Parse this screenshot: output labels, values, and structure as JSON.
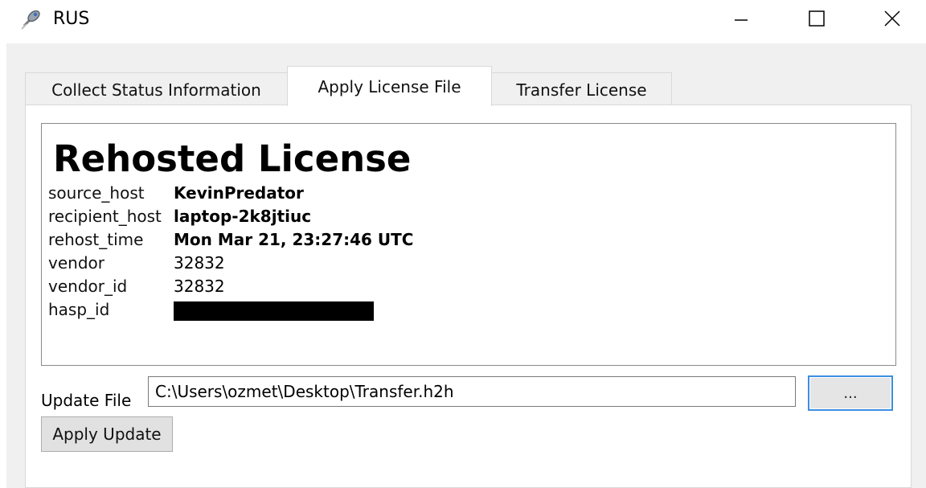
{
  "window": {
    "title": "RUS",
    "app_icon": "satellite-rocket-icon",
    "controls": {
      "minimize_icon": "minimize-icon",
      "maximize_icon": "maximize-icon",
      "close_icon": "close-icon"
    }
  },
  "tabs": [
    {
      "label": "Collect Status Information",
      "active": false
    },
    {
      "label": "Apply License File",
      "active": true
    },
    {
      "label": "Transfer License",
      "active": false
    }
  ],
  "license_info": {
    "heading": "Rehosted License",
    "rows": [
      {
        "key": "source_host",
        "value": "KevinPredator",
        "bold": true
      },
      {
        "key": "recipient_host",
        "value": "laptop-2k8jtiuc",
        "bold": true
      },
      {
        "key": "rehost_time",
        "value": "Mon Mar 21, 23:27:46 UTC",
        "bold": true
      },
      {
        "key": "vendor",
        "value": "32832",
        "bold": false
      },
      {
        "key": "vendor_id",
        "value": "32832",
        "bold": false
      },
      {
        "key": "hasp_id",
        "value": "",
        "redacted": true
      }
    ]
  },
  "update_file": {
    "label": "Update File",
    "value": "C:\\Users\\ozmet\\Desktop\\Transfer.h2h",
    "browse_label": "..."
  },
  "apply_button": {
    "label": "Apply Update"
  },
  "colors": {
    "focus_border": "#3c8ee3",
    "window_bg": "#f0f0f0"
  }
}
